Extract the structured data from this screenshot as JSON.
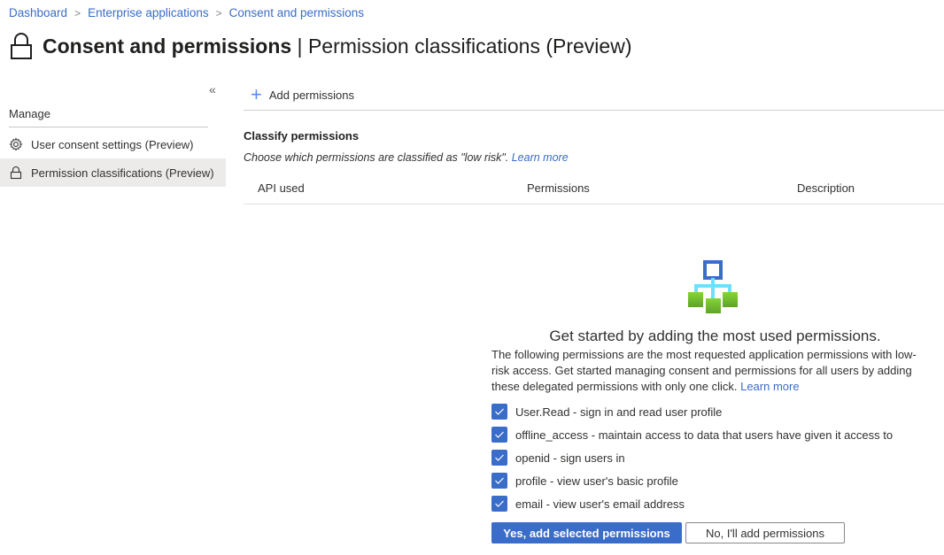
{
  "breadcrumb": [
    {
      "label": "Dashboard"
    },
    {
      "label": "Enterprise applications"
    },
    {
      "label": "Consent and permissions"
    }
  ],
  "header": {
    "title_main": "Consent and permissions",
    "title_sep": " | ",
    "title_sub": "Permission classifications (Preview)",
    "icon": "lock-icon"
  },
  "sidebar": {
    "collapse_glyph": "«",
    "section_label": "Manage",
    "items": [
      {
        "label": "User consent settings (Preview)",
        "icon": "gear-icon",
        "active": false
      },
      {
        "label": "Permission classifications (Preview)",
        "icon": "lock-icon",
        "active": true
      }
    ]
  },
  "toolbar": {
    "add_label": "Add permissions",
    "add_icon": "plus-icon"
  },
  "classify": {
    "title": "Classify permissions",
    "description": "Choose which permissions are classified as \"low risk\". ",
    "learn_more": "Learn more"
  },
  "table": {
    "columns": [
      "API used",
      "Permissions",
      "Description"
    ]
  },
  "empty_state": {
    "icon": "hierarchy-icon",
    "title": "Get started by adding the most used permissions.",
    "description": "The following permissions are the most requested application permissions with low-risk access. Get started managing consent and permissions for all users by adding these delegated permissions with only one click. ",
    "learn_more": "Learn more",
    "permissions": [
      {
        "label": "User.Read - sign in and read user profile",
        "checked": true
      },
      {
        "label": "offline_access - maintain access to data that users have given it access to",
        "checked": true
      },
      {
        "label": "openid - sign users in",
        "checked": true
      },
      {
        "label": "profile - view user's basic profile",
        "checked": true
      },
      {
        "label": "email - view user's email address",
        "checked": true
      }
    ],
    "primary_button": "Yes, add selected permissions",
    "secondary_button": "No, I'll add permissions"
  },
  "colors": {
    "accent": "#3a6cc9",
    "link": "#3a6cc9",
    "active_nav_bg": "#edebe9"
  }
}
